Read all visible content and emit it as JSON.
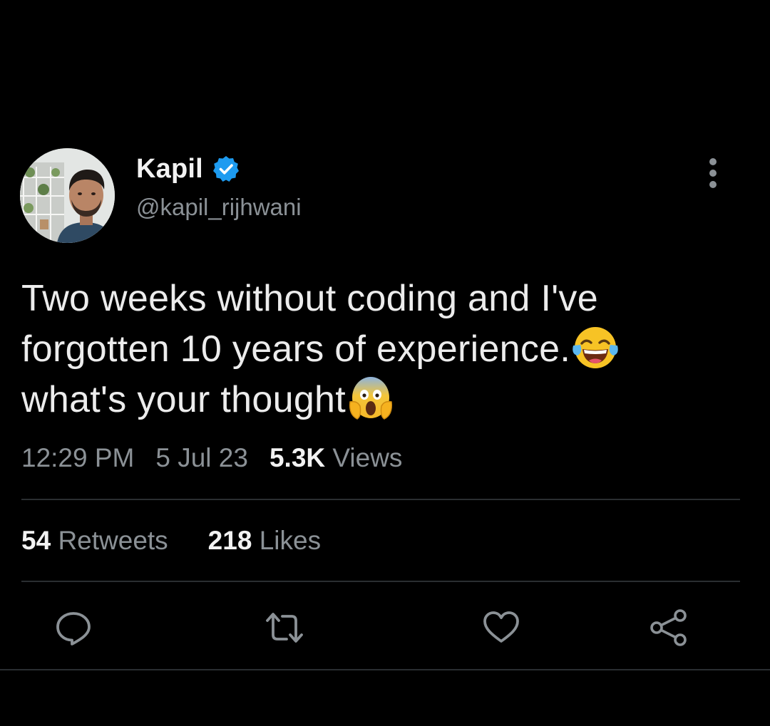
{
  "author": {
    "name": "Kapil",
    "handle": "@kapil_rijhwani",
    "verified": true,
    "icons": {
      "avatar": "profile-photo",
      "verified": "verified-badge-icon",
      "more": "more-options-icon"
    }
  },
  "tweet": {
    "line1": "Two weeks without coding and I've",
    "line2": "forgotten 10 years of experience.",
    "line3": "what's your thought",
    "emoji1": "face-with-tears-of-joy",
    "emoji2": "face-screaming-in-fear"
  },
  "meta": {
    "time": "12:29 PM",
    "date": "5 Jul 23",
    "views_count": "5.3K",
    "views_label": "Views"
  },
  "stats": {
    "retweets_count": "54",
    "retweets_label": "Retweets",
    "likes_count": "218",
    "likes_label": "Likes"
  },
  "actions": [
    "reply-icon",
    "retweet-icon",
    "like-icon",
    "share-icon"
  ],
  "colors": {
    "background": "#000000",
    "primary_text": "#e7e9ea",
    "secondary_text": "#8b9196",
    "divider": "#2a2e31",
    "verified_blue": "#1d9bf0"
  }
}
